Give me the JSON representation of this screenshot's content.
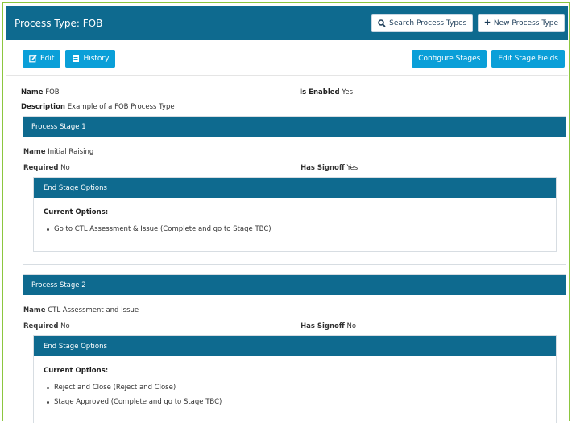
{
  "header": {
    "title": "Process Type: FOB",
    "search_label": "Search Process Types",
    "new_label": "New Process Type"
  },
  "toolbar": {
    "edit_label": "Edit",
    "history_label": "History",
    "configure_label": "Configure Stages",
    "edit_fields_label": "Edit Stage Fields"
  },
  "details": {
    "name_label": "Name",
    "name_value": "FOB",
    "enabled_label": "Is Enabled",
    "enabled_value": "Yes",
    "description_label": "Description",
    "description_value": "Example of a FOB Process Type"
  },
  "stages": [
    {
      "title": "Process Stage 1",
      "name_label": "Name",
      "name_value": "Initial Raising",
      "required_label": "Required",
      "required_value": "No",
      "signoff_label": "Has Signoff",
      "signoff_value": "Yes",
      "options_title": "End Stage Options",
      "current_label": "Current Options:",
      "options": [
        "Go to CTL Assessment & Issue (Complete and go to Stage TBC)"
      ]
    },
    {
      "title": "Process Stage 2",
      "name_label": "Name",
      "name_value": "CTL Assessment and Issue",
      "required_label": "Required",
      "required_value": "No",
      "signoff_label": "Has Signoff",
      "signoff_value": "No",
      "options_title": "End Stage Options",
      "current_label": "Current Options:",
      "options": [
        "Reject and Close (Reject and Close)",
        "Stage Approved (Complete and go to Stage TBC)"
      ]
    }
  ],
  "colors": {
    "header_bg": "#0e6a8f",
    "button_blue": "#0a9fd8",
    "frame_border": "#8cc63f"
  },
  "icons": [
    "search-icon",
    "plus-icon",
    "edit-icon",
    "history-icon"
  ]
}
